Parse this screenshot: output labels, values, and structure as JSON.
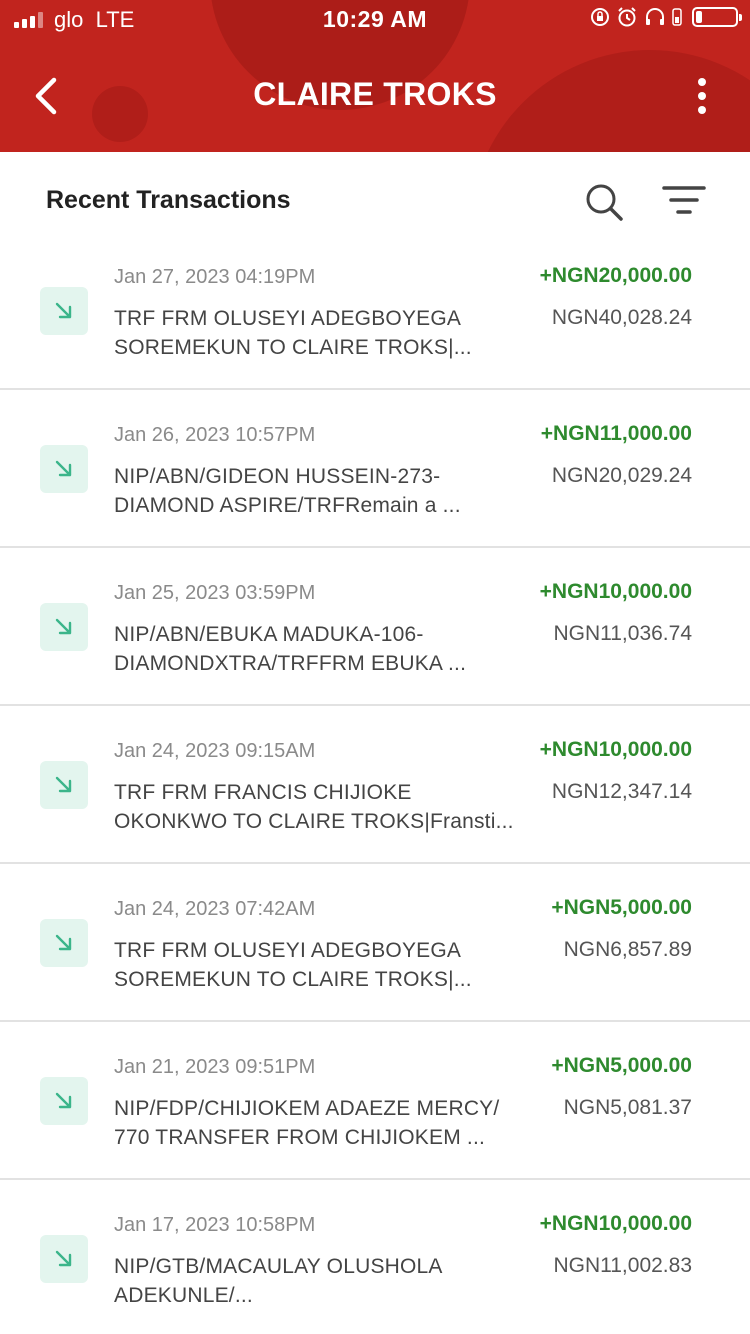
{
  "status_bar": {
    "carrier": "glo",
    "network": "LTE",
    "time": "10:29 AM",
    "battery_level": 0.15
  },
  "header": {
    "title": "CLAIRE TROKS",
    "color": "#c1241e"
  },
  "section": {
    "title": "Recent Transactions"
  },
  "transactions": [
    {
      "date": "Jan 27, 2023 04:19PM",
      "desc1": "TRF FRM OLUSEYI ADEGBOYEGA",
      "desc2": "SOREMEKUN TO CLAIRE TROKS|...",
      "amount": "+NGN20,000.00",
      "balance": "NGN40,028.24"
    },
    {
      "date": "Jan 26, 2023 10:57PM",
      "desc1": "NIP/ABN/GIDEON  HUSSEIN-273-",
      "desc2": "DIAMOND ASPIRE/TRFRemain a ...",
      "amount": "+NGN11,000.00",
      "balance": "NGN20,029.24"
    },
    {
      "date": "Jan 25, 2023 03:59PM",
      "desc1": "NIP/ABN/EBUKA  MADUKA-106-",
      "desc2": "DIAMONDXTRA/TRFFRM EBUKA  ...",
      "amount": "+NGN10,000.00",
      "balance": "NGN11,036.74"
    },
    {
      "date": "Jan 24, 2023 09:15AM",
      "desc1": "TRF FRM FRANCIS CHIJIOKE",
      "desc2": "OKONKWO TO CLAIRE TROKS|Fransti...",
      "amount": "+NGN10,000.00",
      "balance": "NGN12,347.14"
    },
    {
      "date": "Jan 24, 2023 07:42AM",
      "desc1": "TRF FRM OLUSEYI  ADEGBOYEGA",
      "desc2": "SOREMEKUN TO CLAIRE TROKS|...",
      "amount": "+NGN5,000.00",
      "balance": "NGN6,857.89"
    },
    {
      "date": "Jan 21, 2023 09:51PM",
      "desc1": "NIP/FDP/CHIJIOKEM ADAEZE MERCY/",
      "desc2": "770 TRANSFER FROM CHIJIOKEM ...",
      "amount": "+NGN5,000.00",
      "balance": "NGN5,081.37"
    },
    {
      "date": "Jan 17, 2023 10:58PM",
      "desc1": "NIP/GTB/MACAULAY  OLUSHOLA",
      "desc2": "ADEKUNLE/...",
      "amount": "+NGN10,000.00",
      "balance": "NGN11,002.83"
    }
  ],
  "icons": {
    "back": "chevron-left-icon",
    "menu": "kebab-menu-icon",
    "search": "search-icon",
    "filter": "filter-icon",
    "credit": "arrow-down-right-icon"
  },
  "colors": {
    "credit_amount": "#2e8a2e",
    "credit_icon_bg": "#e3f5ee",
    "credit_icon": "#3bb58a"
  }
}
